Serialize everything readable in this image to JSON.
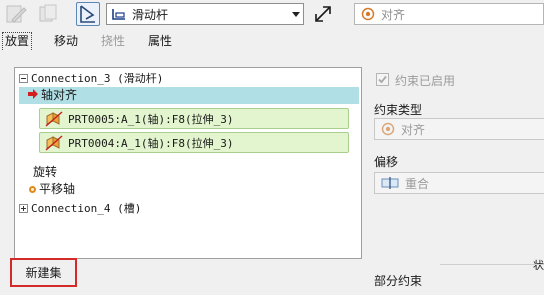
{
  "toolbar": {
    "connection_type": "滑动杆",
    "constraint_type": "对齐"
  },
  "tabs": [
    {
      "label": "放置",
      "state": "active"
    },
    {
      "label": "移动",
      "state": "normal"
    },
    {
      "label": "挠性",
      "state": "disabled"
    },
    {
      "label": "属性",
      "state": "normal"
    }
  ],
  "tree": {
    "connection_3": "Connection_3 (滑动杆)",
    "axis_align": "轴对齐",
    "ref_1": "PRT0005:A_1(轴):F8(拉伸_3)",
    "ref_2": "PRT0004:A_1(轴):F8(拉伸_3)",
    "rotation": "旋转",
    "translation_axis": "平移轴",
    "connection_4": "Connection_4 (槽)"
  },
  "new_set_label": "新建集",
  "right_panel": {
    "constraint_enabled": "约束已启用",
    "constraint_enabled_checked": true,
    "constraint_type_label": "约束类型",
    "constraint_type_value": "对齐",
    "offset_label": "偏移",
    "offset_value": "重合",
    "partial_constraint": "部分约束",
    "status_partial": "状"
  },
  "colors": {
    "selection": "#b0dfe6",
    "reference_box": "#e3f5cf",
    "highlight_border": "#d42a2a"
  }
}
